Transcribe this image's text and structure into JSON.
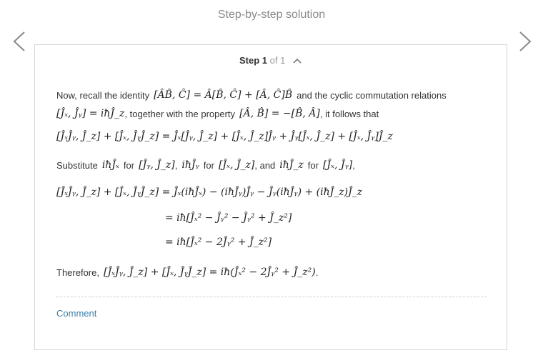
{
  "header": {
    "title": "Step-by-step solution"
  },
  "nav": {
    "prev_icon": "chevron-left-icon",
    "next_icon": "chevron-right-icon"
  },
  "step": {
    "label": "Step 1",
    "of": "of 1"
  },
  "text": {
    "l1a": "Now, recall the identity",
    "l1b": "and the cyclic commutation relations",
    "l2a": ", together with the property",
    "l2b": ", it follows that",
    "l4a": "Substitute",
    "l4b": "for",
    "l4c": ",",
    "l4d": "for",
    "l4e": ", and",
    "l4f": "for",
    "l4g": ",",
    "l8a": "Therefore,",
    "l8b": "."
  },
  "math": {
    "identity": "[ÂB̂, Ĉ] = Â[B̂, Ĉ] + [Â, Ĉ]B̂",
    "cyclic": "[Ĵₓ, Ĵᵧ] = iħĴ_z",
    "property": "[Â, B̂] = −[B̂, Â]",
    "expansion": "[ĴₓĴᵧ, Ĵ_z] + [Ĵₓ, ĴᵧĴ_z] = Ĵₓ[Ĵᵧ, Ĵ_z] + [Ĵₓ, Ĵ_z]Ĵᵧ + Ĵᵧ[Ĵₓ, Ĵ_z] + [Ĵₓ, Ĵᵧ]Ĵ_z",
    "sub1": "iħĴₓ",
    "c1": "[Ĵᵧ, Ĵ_z]",
    "sub2": "iħĴᵧ",
    "c2": "[Ĵₓ, Ĵ_z]",
    "sub3": "iħĴ_z",
    "c3": "[Ĵₓ, Ĵᵧ]",
    "eq1": "[ĴₓĴᵧ, Ĵ_z] + [Ĵₓ, ĴᵧĴ_z] = Ĵₓ(iħĴₓ) − (iħĴᵧ)Ĵᵧ − Ĵᵧ(iħĴᵧ) + (iħĴ_z)Ĵ_z",
    "eq2": "= iħ[Ĵₓ² − Ĵᵧ² − Ĵᵧ² + Ĵ_z²]",
    "eq3": "= iħ[Ĵₓ² − 2Ĵᵧ² + Ĵ_z²]",
    "result": "[ĴₓĴᵧ, Ĵ_z] + [Ĵₓ, ĴᵧĴ_z] = iħ(Ĵₓ² − 2Ĵᵧ² + Ĵ_z²)"
  },
  "footer": {
    "comment": "Comment"
  }
}
